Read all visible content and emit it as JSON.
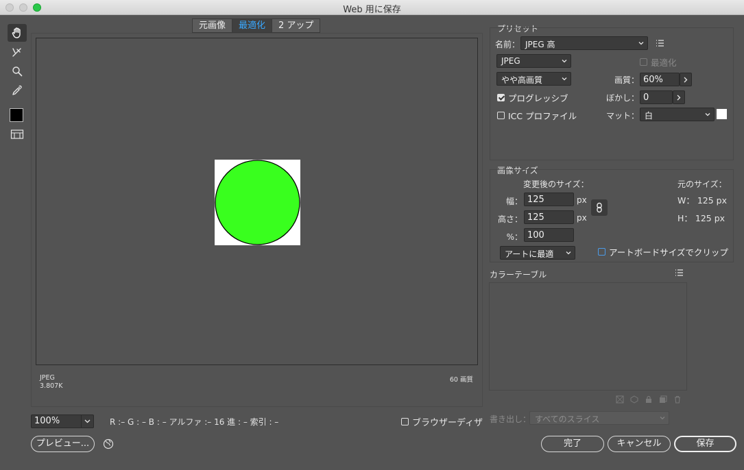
{
  "window": {
    "title": "Web 用に保存"
  },
  "tools": [
    "hand-icon",
    "slice-select-icon",
    "zoom-icon",
    "eyedropper-icon",
    "color-swatch",
    "slice-visibility-icon"
  ],
  "tabs": [
    {
      "label": "元画像",
      "active": false
    },
    {
      "label": "最適化",
      "active": true
    },
    {
      "label": "2 アップ",
      "active": false
    }
  ],
  "preview": {
    "format": "JPEG",
    "size": "3.807K",
    "quality_note": "60 画質",
    "circle_color": "#39ff1e"
  },
  "bottom": {
    "zoom": "100%",
    "readout": "R :–  G : –  B : –  アルファ :–  16 進 : –  索引 : –",
    "browser_dither": "ブラウザーディザ",
    "preview_button": "プレビュー...",
    "done_button": "完了",
    "cancel_button": "キャンセル",
    "save_button": "保存"
  },
  "preset": {
    "group_label": "プリセット",
    "name_label": "名前：",
    "name_value": "JPEG 高",
    "format_value": "JPEG",
    "optimized_label": "最適化",
    "quality_preset": "やや高画質",
    "quality_label": "画質：",
    "quality_value": "60%",
    "progressive_label": "プログレッシブ",
    "progressive_checked": true,
    "blur_label": "ぼかし：",
    "blur_value": "0",
    "icc_label": "ICC プロファイル",
    "icc_checked": false,
    "matte_label": "マット：",
    "matte_value": "白",
    "matte_color": "#ffffff"
  },
  "image_size": {
    "group_label": "画像サイズ",
    "new_size_label": "変更後のサイズ：",
    "orig_size_label": "元のサイズ：",
    "width_label": "幅：",
    "width_value": "125",
    "height_label": "高さ：",
    "height_value": "125",
    "percent_label": "%：",
    "percent_value": "100",
    "unit": "px",
    "orig_w": "W：  125 px",
    "orig_h": "H：  125 px",
    "quality_select": "アートに最適",
    "artboard_clip": "アートボードサイズでクリップ"
  },
  "color_table": {
    "label": "カラーテーブル"
  },
  "export": {
    "label": "書き出し：",
    "value": "すべてのスライス"
  }
}
